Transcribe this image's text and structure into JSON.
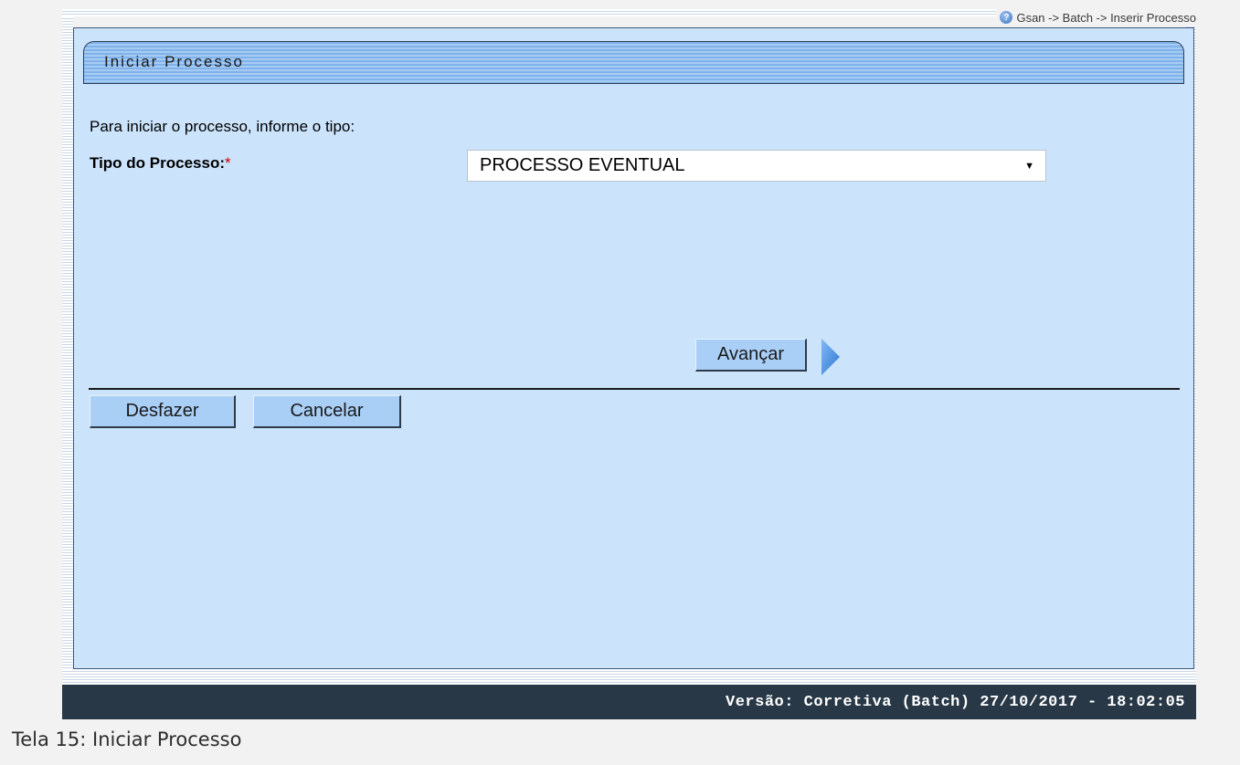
{
  "breadcrumb": {
    "text": "Gsan -> Batch -> Inserir Processo",
    "icon": "help-icon"
  },
  "form": {
    "title": "Iniciar Processo",
    "instruction": "Para iniciar o processo, informe o tipo:",
    "field_label": "Tipo do Processo:",
    "required_mark": "*",
    "select_value": "PROCESSO EVENTUAL",
    "advance_label": "Avançar",
    "undo_label": "Desfazer",
    "cancel_label": "Cancelar"
  },
  "footer": {
    "version": "Versão: Corretiva (Batch) 27/10/2017 - 18:02:05"
  },
  "caption": "Tela 15: Iniciar Processo",
  "colors": {
    "content_bg": "#cbe3fb",
    "title_bar": "#7fb2ea",
    "button_bg": "#a9cff7",
    "footer_bg": "#283846",
    "required": "#d00000"
  }
}
